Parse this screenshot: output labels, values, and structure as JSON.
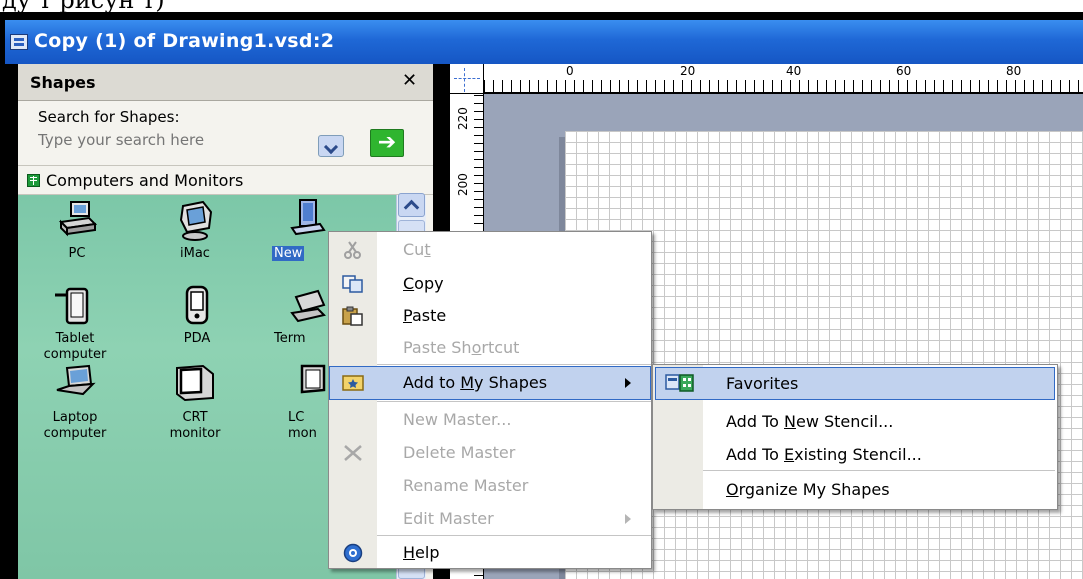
{
  "top_strip_text": "ду т рисун т)",
  "window": {
    "title": "Copy (1) of Drawing1.vsd:2"
  },
  "shapes_pane": {
    "title": "Shapes",
    "close": "✕",
    "search_label": "Search for Shapes:",
    "search_placeholder": "Type your search here",
    "stencil_name": "Computers and Monitors",
    "shapes": [
      {
        "label": "PC",
        "icon": "pc-icon"
      },
      {
        "label": "iMac",
        "icon": "imac-icon"
      },
      {
        "label": "New",
        "icon": "new-shape-icon",
        "selected": true
      },
      {
        "label": "Tablet\ncomputer",
        "icon": "tablet-icon"
      },
      {
        "label": "PDA",
        "icon": "pda-icon"
      },
      {
        "label": "Term",
        "icon": "terminal-icon"
      },
      {
        "label": "Laptop\ncomputer",
        "icon": "laptop-icon"
      },
      {
        "label": "CRT\nmonitor",
        "icon": "crt-monitor-icon"
      },
      {
        "label": "LC\nmon",
        "icon": "lcd-monitor-icon"
      }
    ]
  },
  "ruler": {
    "h_labels": [
      "0",
      "20",
      "40",
      "60",
      "80"
    ],
    "v_labels": [
      "220",
      "200"
    ]
  },
  "context_menu": {
    "items": [
      {
        "label": "Cut",
        "ul": "t",
        "disabled": true,
        "icon": "scissors-icon"
      },
      {
        "label": "Copy",
        "ul": "C",
        "disabled": false,
        "icon": "copy-icon"
      },
      {
        "label": "Paste",
        "ul": "P",
        "disabled": false,
        "icon": "paste-icon"
      },
      {
        "label": "Paste Shortcut",
        "ul": "o",
        "disabled": true,
        "icon": ""
      },
      {
        "label": "Add to My Shapes",
        "ul": "M",
        "disabled": false,
        "icon": "add-to-my-shapes-icon",
        "submenu": true,
        "highlighted": true
      },
      {
        "label": "New Master...",
        "disabled": true,
        "icon": ""
      },
      {
        "label": "Delete Master",
        "disabled": true,
        "icon": "delete-icon"
      },
      {
        "label": "Rename Master",
        "disabled": true,
        "icon": ""
      },
      {
        "label": "Edit Master",
        "disabled": true,
        "icon": "",
        "submenu": true
      },
      {
        "label": "Help",
        "ul": "H",
        "disabled": false,
        "icon": "help-icon"
      }
    ]
  },
  "submenu": {
    "items": [
      {
        "label": "Favorites",
        "highlighted": true,
        "icon": "favorites-stencil-icon"
      },
      {
        "label": "Add To New Stencil..."
      },
      {
        "label": "Add To Existing Stencil..."
      },
      {
        "label": "Organize My Shapes"
      }
    ]
  }
}
